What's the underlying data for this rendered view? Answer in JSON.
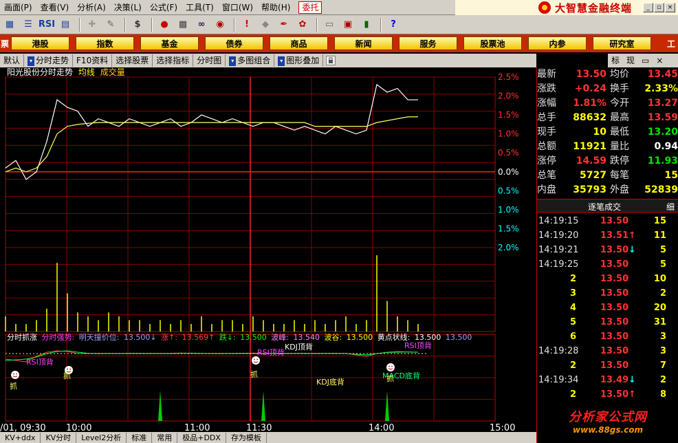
{
  "menubar": {
    "items": [
      "画面(P)",
      "查看(V)",
      "分析(A)",
      "决策(L)",
      "公式(F)",
      "工具(T)",
      "窗口(W)",
      "帮助(H)"
    ],
    "entrust": "委托"
  },
  "brand": {
    "name": "大智慧金融终端"
  },
  "toolbar": {
    "icons": [
      "grid-icon",
      "list-icon",
      "rsi-icon",
      "calc-icon",
      "move-icon",
      "ruler-icon",
      "dollar-icon",
      "signal-icon",
      "pattern-icon",
      "binoculars-icon",
      "broadcast-icon",
      "alert-icon",
      "diamond-icon",
      "pen-icon",
      "brush-icon",
      "eraser-icon",
      "layout-icon",
      "stats-icon",
      "help-icon"
    ],
    "rsi_label": "RSI"
  },
  "tabs": {
    "edge": "票",
    "items": [
      "港股",
      "指数",
      "基金",
      "债券",
      "商品",
      "新闻",
      "服务",
      "股票池",
      "内参",
      "研究室"
    ],
    "right": "工"
  },
  "subtoolbar": {
    "items": [
      "默认",
      "分时走势",
      "F10资料",
      "选择股票",
      "选择指标",
      "分时图",
      "多图组合",
      "图形叠加"
    ]
  },
  "rightheader": {
    "items": [
      "标",
      "现"
    ]
  },
  "chart": {
    "title_name": "阳光股份",
    "title_sub": "分时走势",
    "title_ma": "均线",
    "title_vol": "成交量",
    "right_axis": [
      "2.5%",
      "2.0%",
      "1.5%",
      "1.0%",
      "0.5%",
      "0.0%",
      "0.5%",
      "1.0%",
      "1.5%",
      "2.0%"
    ],
    "time_axis": [
      "/01, 09:30",
      "10:00",
      "11:00",
      "11:30",
      "14:00",
      "15:00"
    ],
    "kdj_bar": {
      "name": "分时抓涨",
      "a": "分时强势:",
      "b": "明天撞价位:",
      "b_val": "13.500↓",
      "c": "涨↑:",
      "c_val": "13.569↑",
      "d": "跌↓:",
      "d_val": "13.500",
      "e": "波峰:",
      "e_val": "13.540",
      "f": "波谷:",
      "f_val": "13.500",
      "g": "黄点状线:",
      "g_val": "13.500",
      "h_val": "13.500"
    },
    "signals": [
      {
        "label": "RSI顶背",
        "color": "#ff40ff"
      },
      {
        "label": "抓",
        "color": "#ffff60"
      },
      {
        "label": "RSI顶背",
        "color": "#ff40ff"
      },
      {
        "label": "KDJ顶背",
        "color": "#ffffff"
      },
      {
        "label": "抓",
        "color": "#ffff60"
      },
      {
        "label": "KDJ底背",
        "color": "#ffff60"
      },
      {
        "label": "MACD底背",
        "color": "#00ff80"
      },
      {
        "label": "RSI顶背",
        "color": "#ff40ff"
      },
      {
        "label": "抓",
        "color": "#ffff60"
      },
      {
        "label": "抓",
        "color": "#ffff60"
      }
    ]
  },
  "chart_data": {
    "type": "line",
    "title": "阳光股份 分时走势",
    "xlabel": "",
    "ylabel": "",
    "x": [
      0,
      6,
      12,
      18,
      24,
      30,
      36,
      42,
      48,
      54,
      60,
      66,
      72,
      78,
      84,
      90,
      96,
      102,
      108,
      114,
      120,
      126,
      132,
      138,
      144,
      150,
      156,
      162,
      168,
      174,
      180,
      186,
      192,
      198,
      204,
      210,
      216,
      222,
      228,
      234,
      240
    ],
    "series": [
      {
        "name": "分时",
        "values": [
          0.1,
          0.3,
          -0.2,
          0.0,
          0.8,
          1.9,
          1.7,
          1.6,
          1.2,
          1.4,
          1.3,
          1.2,
          1.4,
          1.3,
          1.2,
          1.3,
          1.4,
          1.2,
          1.3,
          1.5,
          1.4,
          1.3,
          1.4,
          1.3,
          1.2,
          1.3,
          1.3,
          1.2,
          1.1,
          1.2,
          1.1,
          1.0,
          1.2,
          1.1,
          1.0,
          1.1,
          2.3,
          2.1,
          2.2,
          1.9,
          1.9
        ]
      },
      {
        "name": "均线",
        "values": [
          0.0,
          0.1,
          0.0,
          0.1,
          0.4,
          1.0,
          1.2,
          1.25,
          1.28,
          1.3,
          1.3,
          1.3,
          1.3,
          1.3,
          1.3,
          1.3,
          1.3,
          1.3,
          1.3,
          1.3,
          1.3,
          1.3,
          1.3,
          1.3,
          1.3,
          1.3,
          1.3,
          1.3,
          1.3,
          1.3,
          1.2,
          1.2,
          1.2,
          1.2,
          1.2,
          1.2,
          1.3,
          1.35,
          1.4,
          1.45,
          1.45
        ]
      }
    ],
    "volume": [
      4,
      2,
      2,
      3,
      6,
      18,
      10,
      5,
      4,
      3,
      5,
      4,
      3,
      3,
      2,
      3,
      2,
      3,
      2,
      4,
      2,
      3,
      3,
      2,
      4,
      3,
      2,
      2,
      3,
      2,
      3,
      2,
      3,
      4,
      2,
      3,
      20,
      8,
      4,
      3,
      2
    ],
    "ylim": [
      -2.0,
      2.5
    ]
  },
  "quote": {
    "rows": [
      {
        "l": "最新",
        "v": "13.50",
        "vc": "red",
        "l2": "均价",
        "v2": "13.45",
        "v2c": "red"
      },
      {
        "l": "涨跌",
        "v": "+0.24",
        "vc": "red",
        "l2": "换手",
        "v2": "2.33%",
        "v2c": "yellow"
      },
      {
        "l": "涨幅",
        "v": "1.81%",
        "vc": "red",
        "l2": "今开",
        "v2": "13.27",
        "v2c": "red"
      },
      {
        "l": "总手",
        "v": "88632",
        "vc": "yellow",
        "l2": "最高",
        "v2": "13.59",
        "v2c": "red"
      },
      {
        "l": "现手",
        "v": "10",
        "vc": "yellow",
        "l2": "最低",
        "v2": "13.20",
        "v2c": "green"
      },
      {
        "l": "总额",
        "v": "11921",
        "vc": "yellow",
        "l2": "量比",
        "v2": "0.94",
        "v2c": "white"
      },
      {
        "l": "涨停",
        "v": "14.59",
        "vc": "red",
        "l2": "跌停",
        "v2": "11.93",
        "v2c": "green"
      },
      {
        "l": "总笔",
        "v": "5727",
        "vc": "yellow",
        "l2": "每笔",
        "v2": "15",
        "v2c": "yellow"
      },
      {
        "l": "内盘",
        "v": "35793",
        "vc": "yellow",
        "l2": "外盘",
        "v2": "52839",
        "v2c": "yellow"
      }
    ],
    "trades_title": "逐笔成交",
    "trades_extra": "细",
    "trades": [
      {
        "t": "14:19:15",
        "p": "13.50",
        "pc": "red",
        "v": "15",
        "arrow": ""
      },
      {
        "t": "14:19:20",
        "p": "13.51",
        "pc": "red",
        "v": "11",
        "arrow": "↑"
      },
      {
        "t": "14:19:21",
        "p": "13.50",
        "pc": "red",
        "v": "5",
        "arrow": "↓"
      },
      {
        "t": "14:19:25",
        "p": "13.50",
        "pc": "red",
        "v": "5",
        "arrow": ""
      },
      {
        "t": "2",
        "p": "13.50",
        "pc": "red",
        "v": "10",
        "arrow": ""
      },
      {
        "t": "3",
        "p": "13.50",
        "pc": "red",
        "v": "2",
        "arrow": ""
      },
      {
        "t": "4",
        "p": "13.50",
        "pc": "red",
        "v": "20",
        "arrow": ""
      },
      {
        "t": "5",
        "p": "13.50",
        "pc": "red",
        "v": "31",
        "arrow": ""
      },
      {
        "t": "6",
        "p": "13.50",
        "pc": "red",
        "v": "3",
        "arrow": ""
      },
      {
        "t": "14:19:28",
        "p": "13.50",
        "pc": "red",
        "v": "3",
        "arrow": ""
      },
      {
        "t": "2",
        "p": "13.50",
        "pc": "red",
        "v": "7",
        "arrow": ""
      },
      {
        "t": "14:19:34",
        "p": "13.49",
        "pc": "red",
        "v": "2",
        "arrow": "↓"
      },
      {
        "t": "2",
        "p": "13.50",
        "pc": "red",
        "v": "8",
        "arrow": "↑"
      }
    ]
  },
  "bottomtabs": {
    "items": [
      "KV+ddx",
      "KV分时",
      "Level2分析",
      "标准",
      "常用",
      "极品+DDX",
      "存为模板"
    ]
  },
  "watermark": {
    "title": "分析家公式网",
    "url": "www.88gs.com"
  }
}
